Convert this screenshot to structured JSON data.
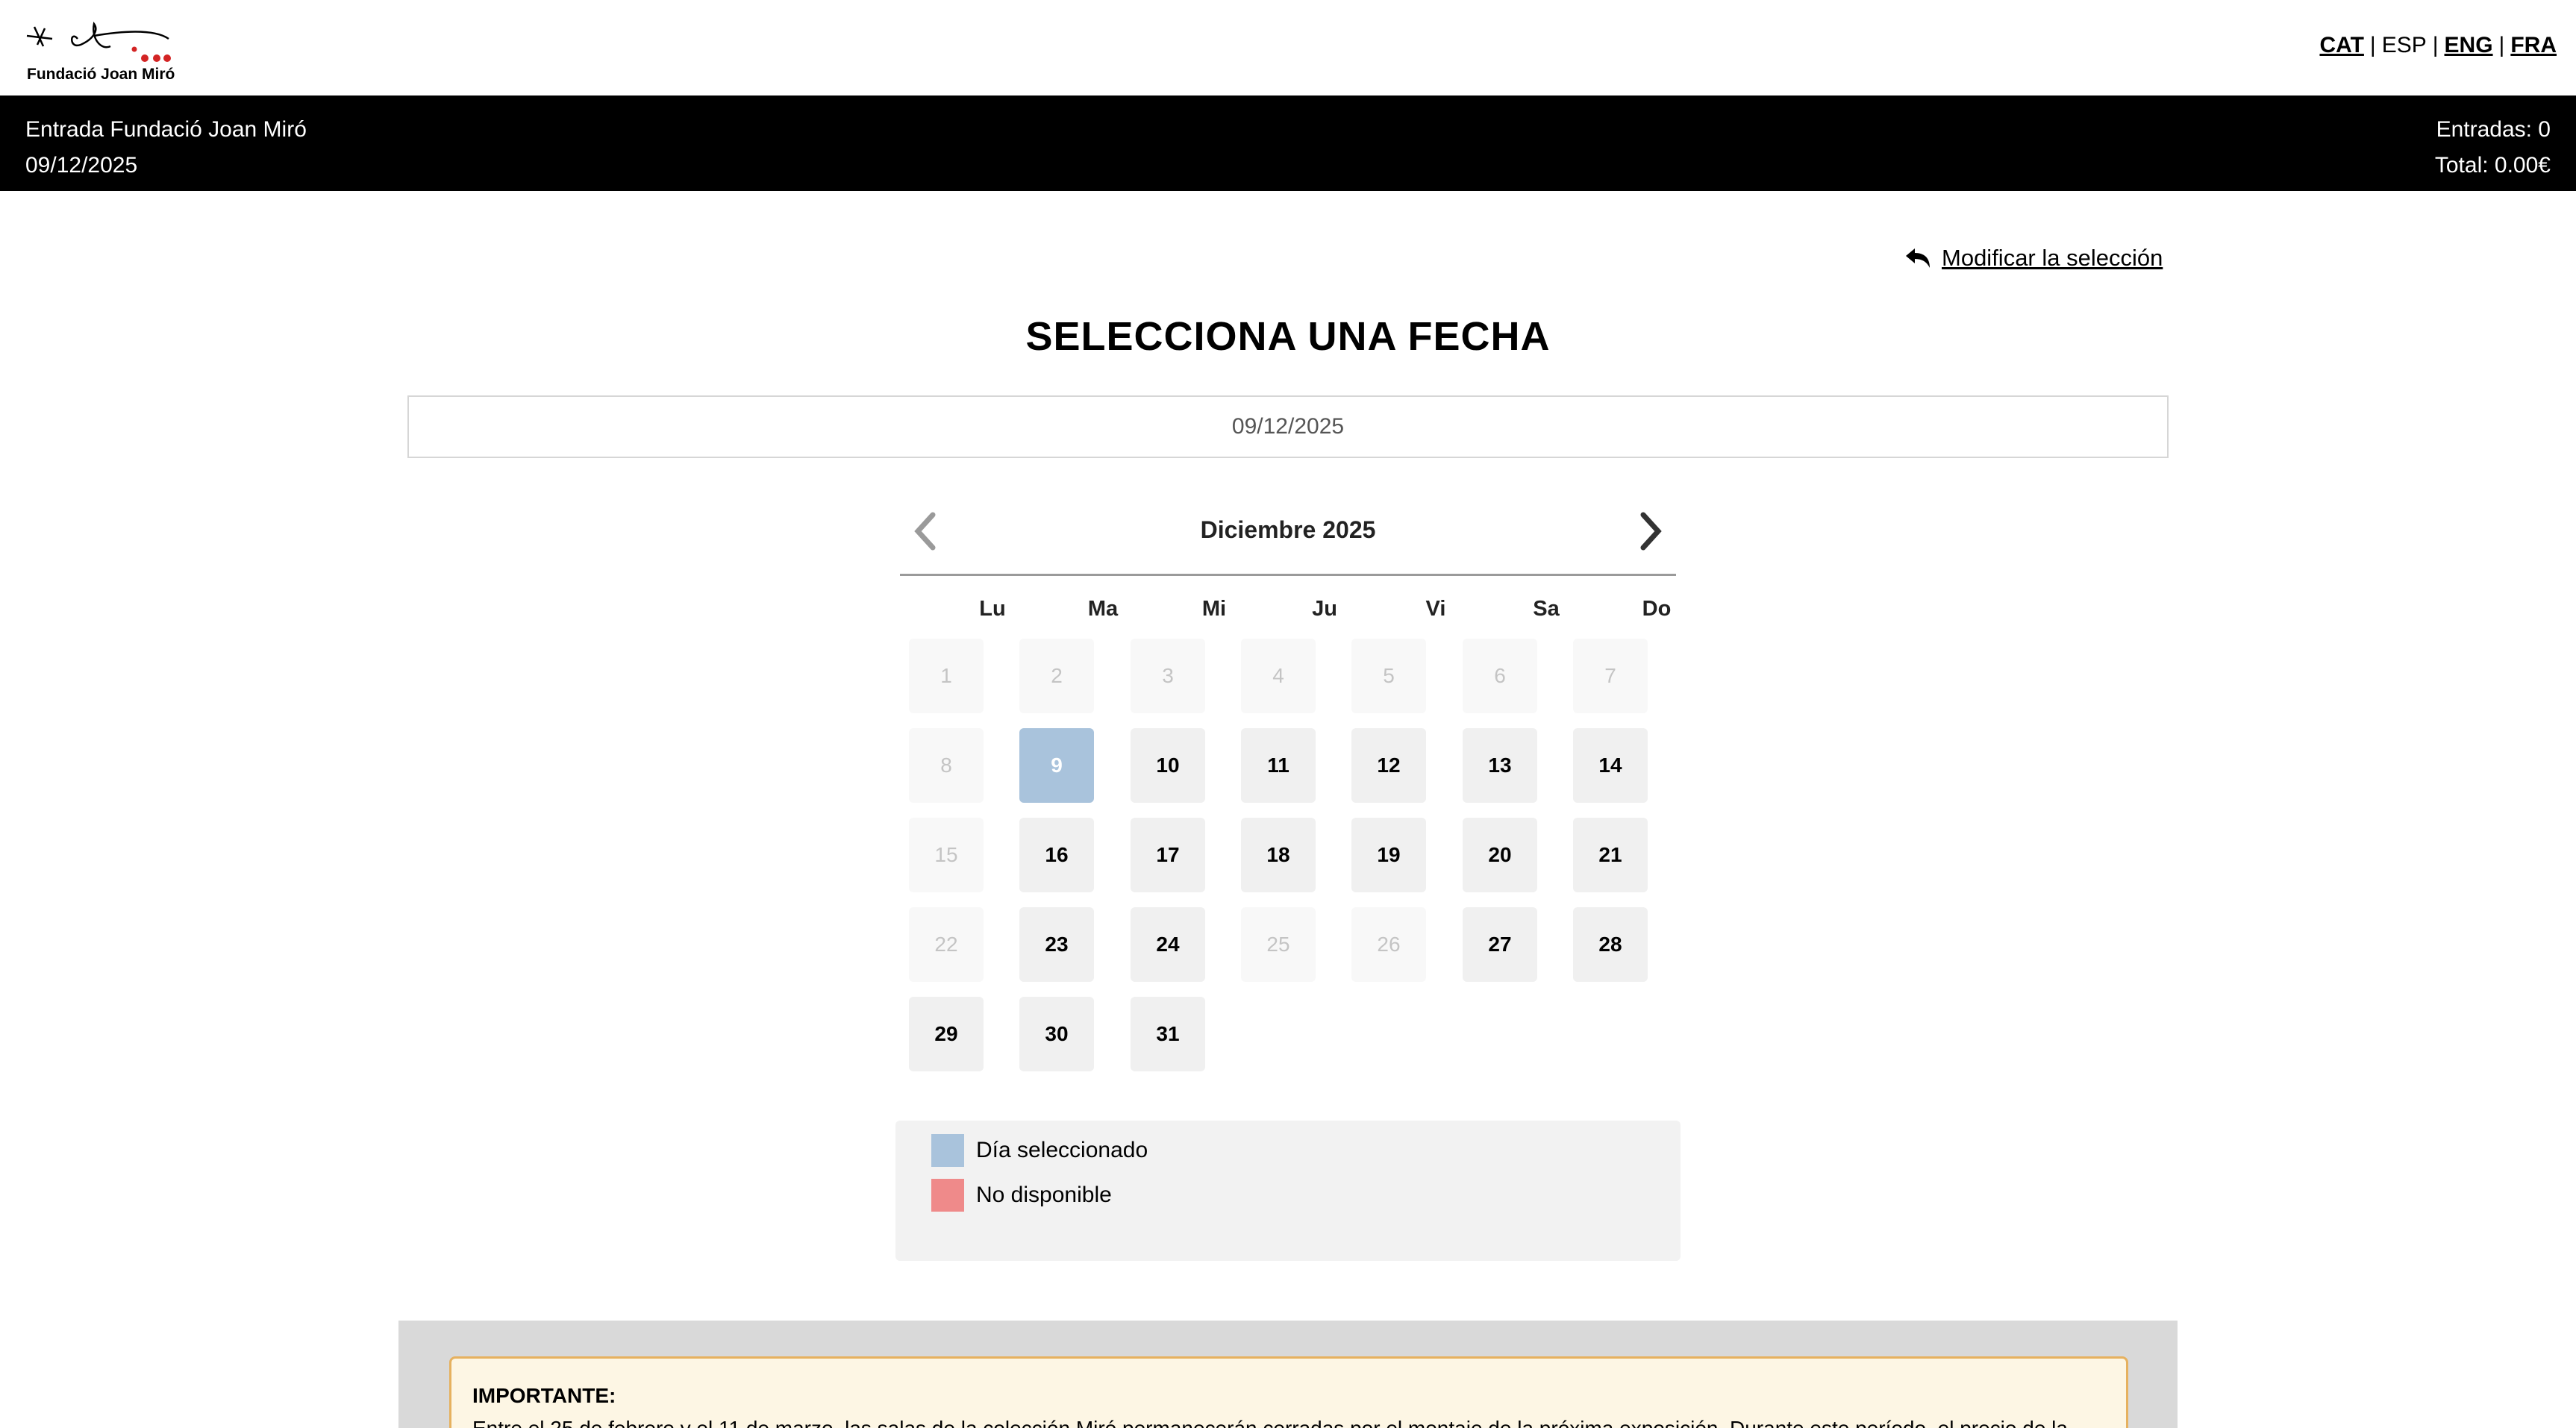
{
  "header": {
    "logo_text": "Fundació Joan Miró",
    "languages": [
      {
        "label": "CAT",
        "link": true
      },
      {
        "label": "ESP",
        "link": false
      },
      {
        "label": "ENG",
        "link": true
      },
      {
        "label": "FRA",
        "link": true
      }
    ],
    "separator": "|"
  },
  "infobar": {
    "ticket_name": "Entrada Fundació Joan Miró",
    "date": "09/12/2025",
    "entries": "Entradas: 0",
    "total": "Total: 0.00€"
  },
  "modify": {
    "label": "Modificar la selección",
    "icon": "undo-arrow-icon"
  },
  "title": "SELECCIONA UNA FECHA",
  "date_input": {
    "value": "09/12/2025"
  },
  "calendar": {
    "month_label": "Diciembre 2025",
    "weekdays": [
      "Lu",
      "Ma",
      "Mi",
      "Ju",
      "Vi",
      "Sa",
      "Do"
    ],
    "weeks": [
      [
        {
          "d": "1",
          "s": "disabled"
        },
        {
          "d": "2",
          "s": "disabled"
        },
        {
          "d": "3",
          "s": "disabled"
        },
        {
          "d": "4",
          "s": "disabled"
        },
        {
          "d": "5",
          "s": "disabled"
        },
        {
          "d": "6",
          "s": "disabled"
        },
        {
          "d": "7",
          "s": "disabled"
        }
      ],
      [
        {
          "d": "8",
          "s": "disabled"
        },
        {
          "d": "9",
          "s": "selected"
        },
        {
          "d": "10",
          "s": "available"
        },
        {
          "d": "11",
          "s": "available"
        },
        {
          "d": "12",
          "s": "available"
        },
        {
          "d": "13",
          "s": "available"
        },
        {
          "d": "14",
          "s": "available"
        }
      ],
      [
        {
          "d": "15",
          "s": "disabled"
        },
        {
          "d": "16",
          "s": "available"
        },
        {
          "d": "17",
          "s": "available"
        },
        {
          "d": "18",
          "s": "available"
        },
        {
          "d": "19",
          "s": "available"
        },
        {
          "d": "20",
          "s": "available"
        },
        {
          "d": "21",
          "s": "available"
        }
      ],
      [
        {
          "d": "22",
          "s": "disabled"
        },
        {
          "d": "23",
          "s": "available"
        },
        {
          "d": "24",
          "s": "available"
        },
        {
          "d": "25",
          "s": "disabled"
        },
        {
          "d": "26",
          "s": "disabled"
        },
        {
          "d": "27",
          "s": "available"
        },
        {
          "d": "28",
          "s": "available"
        }
      ],
      [
        {
          "d": "29",
          "s": "available"
        },
        {
          "d": "30",
          "s": "available"
        },
        {
          "d": "31",
          "s": "available"
        }
      ]
    ]
  },
  "legend": {
    "selected": {
      "label": "Día seleccionado",
      "color": "#a9c3dc"
    },
    "unavailable": {
      "label": "No disponible",
      "color": "#ef8a8a"
    }
  },
  "notice": {
    "heading": "IMPORTANTE:",
    "body": "Entre el 25 de febrero y el 11 de marzo, las salas de la colección Miró permanecerán cerradas por el montaje de la próxima exposición. Durante este período, el precio de la"
  },
  "colors": {
    "accent_selected": "#a9c3dc",
    "unavailable": "#ef8a8a",
    "infobar_bg": "#000000",
    "notice_border": "#e6b15f"
  }
}
